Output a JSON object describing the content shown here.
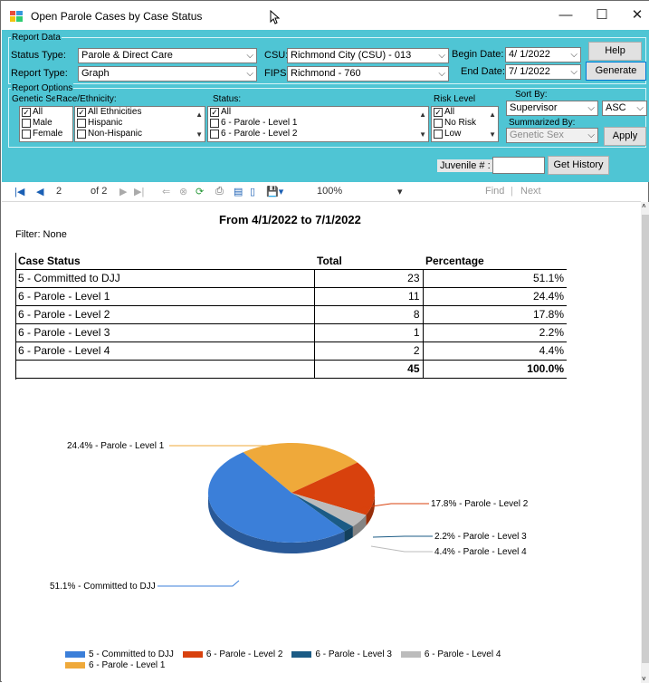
{
  "window": {
    "title": "Open Parole Cases by Case Status",
    "minimize": "—",
    "maximize": "☐",
    "close": "✕"
  },
  "report_data": {
    "group_label": "Report Data",
    "status_type_label": "Status Type:",
    "status_type_value": "Parole & Direct Care",
    "report_type_label": "Report Type:",
    "report_type_value": "Graph",
    "csu_label": "CSU:",
    "csu_value": "Richmond City (CSU) - 013",
    "fips_label": "FIPS:",
    "fips_value": "Richmond - 760",
    "begin_date_label": "Begin Date:",
    "begin_date_value": "4/ 1/2022",
    "end_date_label": "End Date:",
    "end_date_value": "7/ 1/2022",
    "help_label": "Help",
    "generate_label": "Generate"
  },
  "report_options": {
    "group_label": "Report Options",
    "genetic_sex_label": "Genetic Sex:",
    "genetic_sex_items": [
      {
        "label": "All",
        "checked": true
      },
      {
        "label": "Male",
        "checked": false
      },
      {
        "label": "Female",
        "checked": false
      }
    ],
    "race_label": "Race/Ethnicity:",
    "race_items": [
      {
        "label": "All Ethnicities",
        "checked": true
      },
      {
        "label": "Hispanic",
        "checked": false
      },
      {
        "label": "Non-Hispanic",
        "checked": false
      }
    ],
    "status_label": "Status:",
    "status_items": [
      {
        "label": "All",
        "checked": true
      },
      {
        "label": "6 - Parole - Level 1",
        "checked": false
      },
      {
        "label": "6 - Parole - Level 2",
        "checked": false
      }
    ],
    "risk_label": "Risk Level",
    "risk_items": [
      {
        "label": "All",
        "checked": true
      },
      {
        "label": "No Risk",
        "checked": false
      },
      {
        "label": "Low",
        "checked": false
      }
    ],
    "sort_by_label": "Sort By:",
    "sort_by_value": "Supervisor",
    "sort_dir_value": "ASC",
    "summarized_by_label": "Summarized By:",
    "summarized_by_value": "Genetic Sex",
    "apply_label": "Apply"
  },
  "juvenile": {
    "label": "Juvenile # :",
    "value": "",
    "button": "Get History"
  },
  "toolbar": {
    "page": "2",
    "of_pages": "of 2",
    "zoom": "100%",
    "find": "Find",
    "separator": "|",
    "next": "Next"
  },
  "report": {
    "heading": "From 4/1/2022 to 7/1/2022",
    "filter": "Filter: None",
    "columns": [
      "Case Status",
      "Total",
      "Percentage"
    ],
    "rows": [
      {
        "status": "5 - Committed to DJJ",
        "total": "23",
        "pct": "51.1%"
      },
      {
        "status": "6 - Parole - Level 1",
        "total": "11",
        "pct": "24.4%"
      },
      {
        "status": "6 - Parole - Level 2",
        "total": "8",
        "pct": "17.8%"
      },
      {
        "status": "6 - Parole - Level 3",
        "total": "1",
        "pct": "2.2%"
      },
      {
        "status": "6 - Parole - Level 4",
        "total": "2",
        "pct": "4.4%"
      }
    ],
    "total": "45",
    "total_pct": "100.0%"
  },
  "chart_data": {
    "type": "pie",
    "categories": [
      "5 - Committed to DJJ",
      "6 - Parole - Level 1",
      "6 - Parole - Level 2",
      "6 - Parole - Level 3",
      "6 - Parole - Level 4"
    ],
    "values": [
      23,
      11,
      8,
      1,
      2
    ],
    "labels": [
      "51.1% - Committed to DJJ",
      "24.4% - Parole - Level 1",
      "17.8% - Parole - Level 2",
      "2.2% - Parole - Level 3",
      "4.4% - Parole - Level 4"
    ],
    "colors": [
      "#3b7fd9",
      "#efa93a",
      "#d8410d",
      "#1b5b85",
      "#bcbcbc"
    ],
    "legend": [
      "5 - Committed to DJJ",
      "6 - Parole - Level 2",
      "6 - Parole - Level 3",
      "6 - Parole - Level 4",
      "6 - Parole - Level 1"
    ],
    "legend_colors": [
      "#3b7fd9",
      "#d8410d",
      "#1b5b85",
      "#bcbcbc",
      "#efa93a"
    ],
    "legend_position": "bottom"
  }
}
